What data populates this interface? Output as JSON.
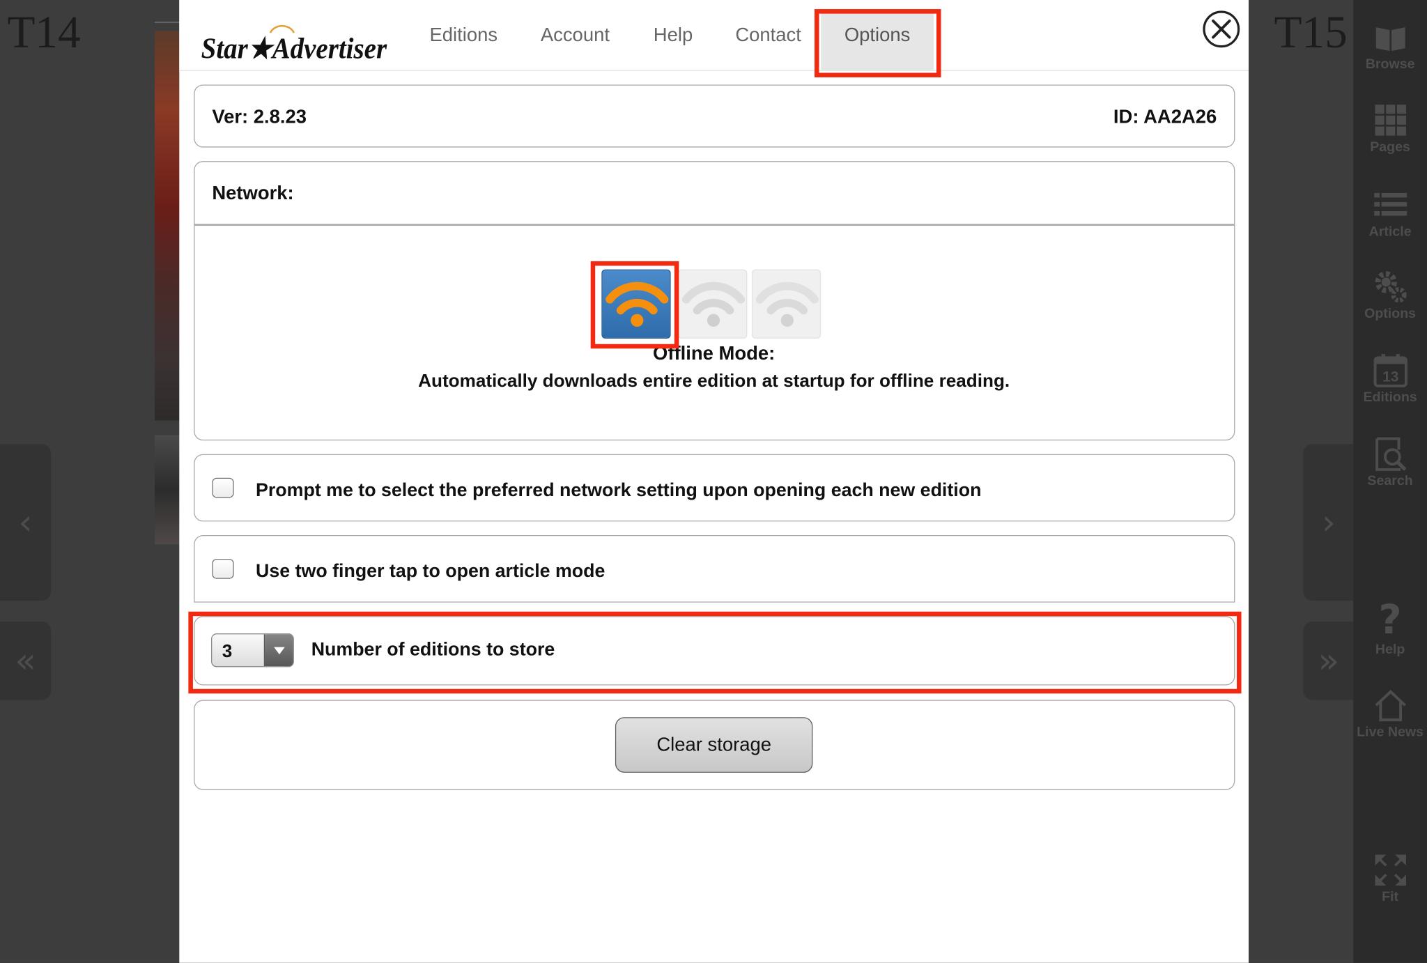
{
  "background": {
    "left_page_label": "T14",
    "right_page_label": "T15",
    "prev_arrow": "‹",
    "next_arrow": "›",
    "first_arrow": "«",
    "last_arrow": "»"
  },
  "toolbar": {
    "items": [
      {
        "label": "Browse",
        "icon": "book-icon"
      },
      {
        "label": "Pages",
        "icon": "grid-icon"
      },
      {
        "label": "Article",
        "icon": "list-icon"
      },
      {
        "label": "Options",
        "icon": "gears-icon"
      },
      {
        "label": "Editions",
        "icon": "calendar-icon",
        "badge": "13"
      },
      {
        "label": "Search",
        "icon": "search-page-icon"
      },
      {
        "label": "Help",
        "icon": "question-icon",
        "glyph": "?"
      },
      {
        "label": "Live News",
        "icon": "home-icon"
      },
      {
        "label": "Fit",
        "icon": "fit-icon"
      }
    ]
  },
  "modal": {
    "logo_text": "Star★Advertiser",
    "tabs": [
      "Editions",
      "Account",
      "Help",
      "Contact",
      "Options"
    ],
    "active_tab": "Options",
    "version": "Ver: 2.8.23",
    "id": "ID: AA2A26",
    "network_label": "Network:",
    "network_modes": [
      "online",
      "offline",
      "none"
    ],
    "selected_mode": "offline",
    "mode_title": "Offline Mode:",
    "mode_description": "Automatically downloads entire edition at startup for offline reading.",
    "prompt_checkbox_label": "Prompt me to select the preferred network setting upon opening each new edition",
    "prompt_checked": false,
    "two_finger_label": "Use two finger tap to open article mode",
    "two_finger_checked": false,
    "editions_to_store_value": "3",
    "editions_to_store_label": "Number of editions to store",
    "clear_storage_label": "Clear storage"
  },
  "colors": {
    "highlight": "#f32a12",
    "selected_mode_blue": "#3a77b8",
    "wifi_orange": "#f5900f",
    "toolbar_text": "#4d4d4d"
  }
}
